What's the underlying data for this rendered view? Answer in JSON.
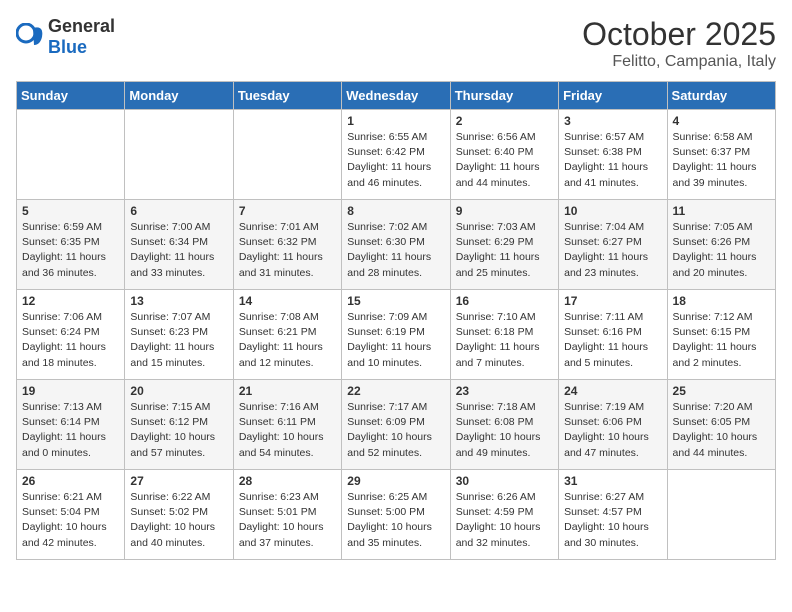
{
  "header": {
    "logo_general": "General",
    "logo_blue": "Blue",
    "month_title": "October 2025",
    "location": "Felitto, Campania, Italy"
  },
  "days_of_week": [
    "Sunday",
    "Monday",
    "Tuesday",
    "Wednesday",
    "Thursday",
    "Friday",
    "Saturday"
  ],
  "weeks": [
    [
      {
        "day": "",
        "content": ""
      },
      {
        "day": "",
        "content": ""
      },
      {
        "day": "",
        "content": ""
      },
      {
        "day": "1",
        "content": "Sunrise: 6:55 AM\nSunset: 6:42 PM\nDaylight: 11 hours and 46 minutes."
      },
      {
        "day": "2",
        "content": "Sunrise: 6:56 AM\nSunset: 6:40 PM\nDaylight: 11 hours and 44 minutes."
      },
      {
        "day": "3",
        "content": "Sunrise: 6:57 AM\nSunset: 6:38 PM\nDaylight: 11 hours and 41 minutes."
      },
      {
        "day": "4",
        "content": "Sunrise: 6:58 AM\nSunset: 6:37 PM\nDaylight: 11 hours and 39 minutes."
      }
    ],
    [
      {
        "day": "5",
        "content": "Sunrise: 6:59 AM\nSunset: 6:35 PM\nDaylight: 11 hours and 36 minutes."
      },
      {
        "day": "6",
        "content": "Sunrise: 7:00 AM\nSunset: 6:34 PM\nDaylight: 11 hours and 33 minutes."
      },
      {
        "day": "7",
        "content": "Sunrise: 7:01 AM\nSunset: 6:32 PM\nDaylight: 11 hours and 31 minutes."
      },
      {
        "day": "8",
        "content": "Sunrise: 7:02 AM\nSunset: 6:30 PM\nDaylight: 11 hours and 28 minutes."
      },
      {
        "day": "9",
        "content": "Sunrise: 7:03 AM\nSunset: 6:29 PM\nDaylight: 11 hours and 25 minutes."
      },
      {
        "day": "10",
        "content": "Sunrise: 7:04 AM\nSunset: 6:27 PM\nDaylight: 11 hours and 23 minutes."
      },
      {
        "day": "11",
        "content": "Sunrise: 7:05 AM\nSunset: 6:26 PM\nDaylight: 11 hours and 20 minutes."
      }
    ],
    [
      {
        "day": "12",
        "content": "Sunrise: 7:06 AM\nSunset: 6:24 PM\nDaylight: 11 hours and 18 minutes."
      },
      {
        "day": "13",
        "content": "Sunrise: 7:07 AM\nSunset: 6:23 PM\nDaylight: 11 hours and 15 minutes."
      },
      {
        "day": "14",
        "content": "Sunrise: 7:08 AM\nSunset: 6:21 PM\nDaylight: 11 hours and 12 minutes."
      },
      {
        "day": "15",
        "content": "Sunrise: 7:09 AM\nSunset: 6:19 PM\nDaylight: 11 hours and 10 minutes."
      },
      {
        "day": "16",
        "content": "Sunrise: 7:10 AM\nSunset: 6:18 PM\nDaylight: 11 hours and 7 minutes."
      },
      {
        "day": "17",
        "content": "Sunrise: 7:11 AM\nSunset: 6:16 PM\nDaylight: 11 hours and 5 minutes."
      },
      {
        "day": "18",
        "content": "Sunrise: 7:12 AM\nSunset: 6:15 PM\nDaylight: 11 hours and 2 minutes."
      }
    ],
    [
      {
        "day": "19",
        "content": "Sunrise: 7:13 AM\nSunset: 6:14 PM\nDaylight: 11 hours and 0 minutes."
      },
      {
        "day": "20",
        "content": "Sunrise: 7:15 AM\nSunset: 6:12 PM\nDaylight: 10 hours and 57 minutes."
      },
      {
        "day": "21",
        "content": "Sunrise: 7:16 AM\nSunset: 6:11 PM\nDaylight: 10 hours and 54 minutes."
      },
      {
        "day": "22",
        "content": "Sunrise: 7:17 AM\nSunset: 6:09 PM\nDaylight: 10 hours and 52 minutes."
      },
      {
        "day": "23",
        "content": "Sunrise: 7:18 AM\nSunset: 6:08 PM\nDaylight: 10 hours and 49 minutes."
      },
      {
        "day": "24",
        "content": "Sunrise: 7:19 AM\nSunset: 6:06 PM\nDaylight: 10 hours and 47 minutes."
      },
      {
        "day": "25",
        "content": "Sunrise: 7:20 AM\nSunset: 6:05 PM\nDaylight: 10 hours and 44 minutes."
      }
    ],
    [
      {
        "day": "26",
        "content": "Sunrise: 6:21 AM\nSunset: 5:04 PM\nDaylight: 10 hours and 42 minutes."
      },
      {
        "day": "27",
        "content": "Sunrise: 6:22 AM\nSunset: 5:02 PM\nDaylight: 10 hours and 40 minutes."
      },
      {
        "day": "28",
        "content": "Sunrise: 6:23 AM\nSunset: 5:01 PM\nDaylight: 10 hours and 37 minutes."
      },
      {
        "day": "29",
        "content": "Sunrise: 6:25 AM\nSunset: 5:00 PM\nDaylight: 10 hours and 35 minutes."
      },
      {
        "day": "30",
        "content": "Sunrise: 6:26 AM\nSunset: 4:59 PM\nDaylight: 10 hours and 32 minutes."
      },
      {
        "day": "31",
        "content": "Sunrise: 6:27 AM\nSunset: 4:57 PM\nDaylight: 10 hours and 30 minutes."
      },
      {
        "day": "",
        "content": ""
      }
    ]
  ]
}
